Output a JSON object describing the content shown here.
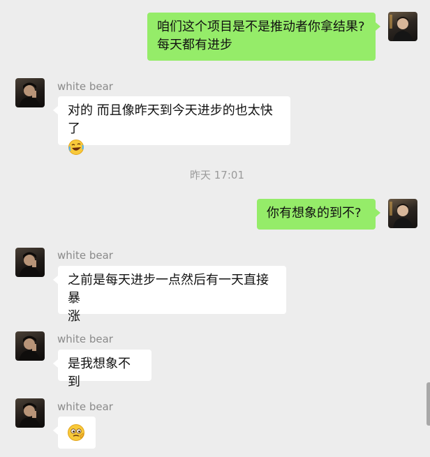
{
  "messages": [
    {
      "sender": "self",
      "text_line1": "咱们这个项目是不是推动者你拿结果?",
      "text_line2": "每天都有进步"
    },
    {
      "sender": "white bear",
      "text": "对的 而且像昨天到今天进步的也太快了",
      "emoji": "rolling-laughing-emoji"
    },
    {
      "sender": "self",
      "text": "你有想象的到不?"
    },
    {
      "sender": "white bear",
      "text_line1": "之前是每天进步一点然后有一天直接暴",
      "text_line2": "涨"
    },
    {
      "sender": "white bear",
      "text": "是我想象不到"
    },
    {
      "sender": "white bear",
      "emoji": "thinking-face-emoji"
    }
  ],
  "timestamp": "昨天 17:01",
  "colors": {
    "background": "#ededed",
    "outgoing_bubble": "#95ec69",
    "incoming_bubble": "#ffffff",
    "sender_name": "#8a8a8a"
  }
}
